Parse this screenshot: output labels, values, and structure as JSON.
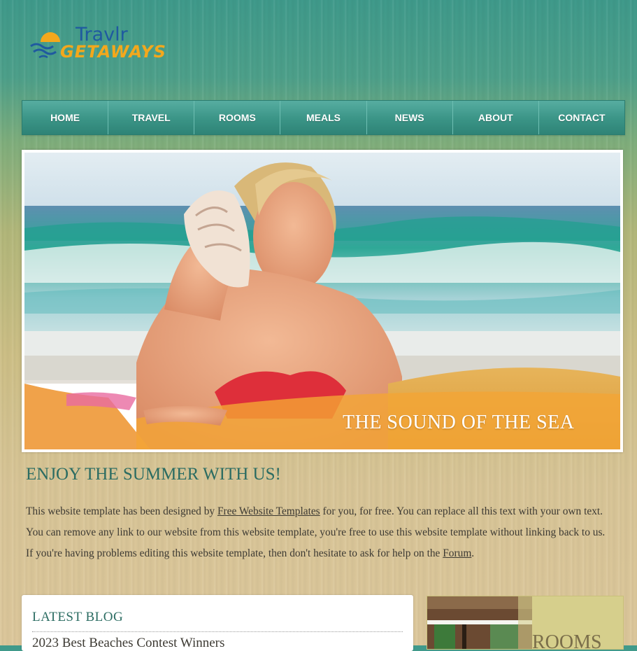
{
  "logo": {
    "word1": "Travlr",
    "word2": "GETAWAYS"
  },
  "nav": {
    "items": [
      {
        "label": "HOME"
      },
      {
        "label": "TRAVEL"
      },
      {
        "label": "ROOMS"
      },
      {
        "label": "MEALS"
      },
      {
        "label": "NEWS"
      },
      {
        "label": "ABOUT"
      },
      {
        "label": "CONTACT"
      }
    ]
  },
  "hero": {
    "caption": "THE SOUND OF THE SEA"
  },
  "main": {
    "heading": "ENJOY THE SUMMER WITH US!",
    "intro": {
      "part1": "This website template has been designed by ",
      "link1": "Free Website Templates",
      "part2": " for you, for free. You can replace all this text with your own text. You can remove any link to our website from this website template, you're free to use this website template without linking back to us. If you're having problems editing this website template, then don't hesitate to ask for help on the ",
      "link2": "Forum",
      "part3": "."
    }
  },
  "blog": {
    "title": "LATEST BLOG",
    "first_post": "2023 Best Beaches Contest Winners"
  },
  "rooms": {
    "label": "ROOMS"
  },
  "colors": {
    "accent": "#2b6c62",
    "nav": "#3c9688",
    "logo_blue": "#1f5aa0",
    "logo_orange": "#f3a81c"
  }
}
